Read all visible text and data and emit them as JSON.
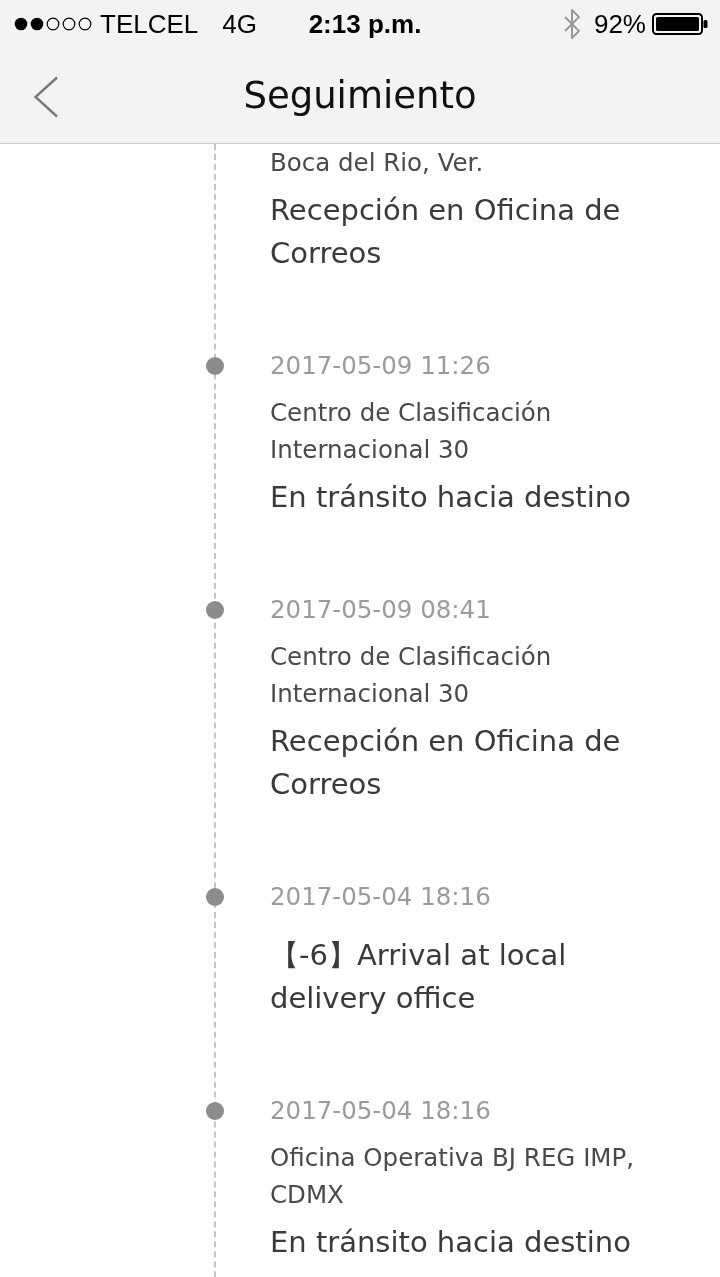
{
  "status_bar": {
    "carrier": "TELCEL",
    "network": "4G",
    "time": "2:13 p.m.",
    "battery": "92%"
  },
  "nav": {
    "title": "Seguimiento"
  },
  "events": [
    {
      "location": "Boca del Rio, Ver.",
      "status": "Recepción en Oficina de Correos"
    },
    {
      "date": "2017-05-09 11:26",
      "location": "Centro de Clasificación Internacional 30",
      "status": "En tránsito hacia destino"
    },
    {
      "date": "2017-05-09 08:41",
      "location": "Centro de Clasificación Internacional 30",
      "status": "Recepción en Oficina de Correos"
    },
    {
      "date": "2017-05-04 18:16",
      "status": "【-6】Arrival at local delivery office"
    },
    {
      "date": "2017-05-04 18:16",
      "location": "Oficina Operativa BJ REG IMP, CDMX",
      "status": "En tránsito hacia destino"
    }
  ]
}
